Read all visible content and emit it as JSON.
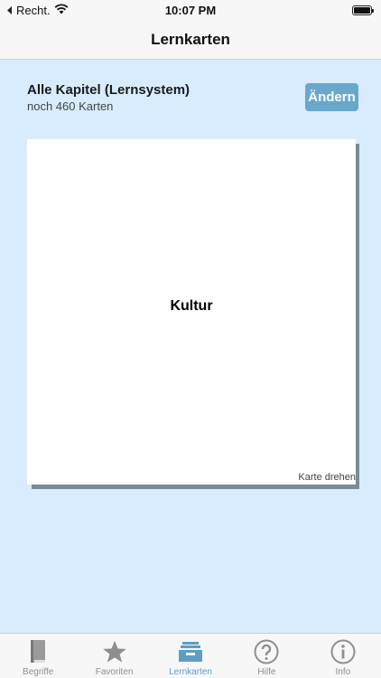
{
  "status_bar": {
    "carrier": "Recht.",
    "time": "10:07 PM"
  },
  "nav": {
    "title": "Lernkarten"
  },
  "deck": {
    "title": "Alle Kapitel (Lernsystem)",
    "remaining": "noch 460 Karten",
    "change_label": "Ändern"
  },
  "card": {
    "term": "Kultur",
    "flip_label": "Karte drehen"
  },
  "tabs": [
    {
      "label": "Begriffe",
      "icon": "book-icon"
    },
    {
      "label": "Favoriten",
      "icon": "star-icon"
    },
    {
      "label": "Lernkarten",
      "icon": "card-box-icon",
      "active": true
    },
    {
      "label": "Hilfe",
      "icon": "question-icon"
    },
    {
      "label": "Info",
      "icon": "info-icon"
    }
  ],
  "colors": {
    "background": "#d8ecfd",
    "accent": "#69a8cc",
    "active_tab": "#5c9ec5",
    "inactive_tab": "#8e8e8e"
  }
}
